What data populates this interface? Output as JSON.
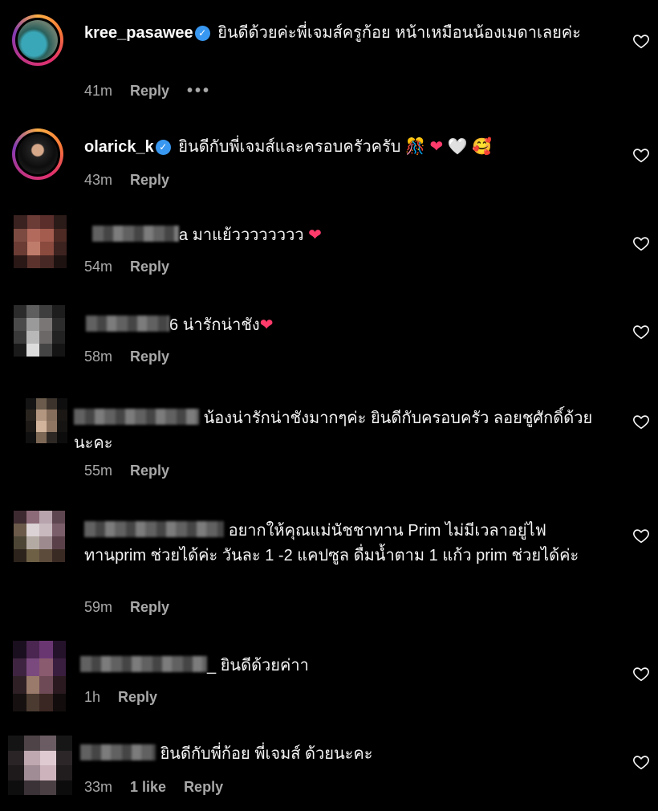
{
  "comments": [
    {
      "username": "kree_pasawee",
      "verified": true,
      "text": "ยินดีด้วยค่ะพี่เจมส์ครูก้อย หน้าเหมือนน้องเมดาเลยค่ะ",
      "time": "41m",
      "reply": "Reply",
      "more": "•••"
    },
    {
      "username": "olarick_k",
      "verified": true,
      "text": "ยินดีกับพี่เจมส์และครอบครัวครับ",
      "emojis": [
        "🎊",
        "❤",
        "🤍",
        "🥰"
      ],
      "time": "43m",
      "reply": "Reply"
    },
    {
      "prefix": "a",
      "text": "มาแย้วววววววว",
      "emojis": [
        "❤"
      ],
      "time": "54m",
      "reply": "Reply"
    },
    {
      "prefix": "6",
      "text": "น่ารักน่าชัง",
      "emojis": [
        "❤"
      ],
      "time": "58m",
      "reply": "Reply"
    },
    {
      "text": "น้องน่ารักน่าชังมากๆค่ะ ยินดีกับครอบครัว ลอยชูศักดิ์ด้วยนะคะ",
      "time": "55m",
      "reply": "Reply"
    },
    {
      "text": "อยากให้คุณแม่นัชชาทาน Prim ไม่มีเวลาอยู่ไฟ ทานprim ช่วยได้ค่ะ วันละ 1 -2 แคปซูล ดื่มน้ำตาม 1 แก้ว prim ช่วยได้ค่ะ",
      "time": "59m",
      "reply": "Reply"
    },
    {
      "prefix": "_",
      "text": "ยินดีด้วยค่าา",
      "time": "1h",
      "reply": "Reply"
    },
    {
      "text": "ยินดีกับพี่ก้อย พี่เจมส์ ด้วยนะคะ",
      "time": "33m",
      "likes": "1 like",
      "reply": "Reply"
    }
  ],
  "icons": {
    "like": "heart-outline-icon",
    "verified": "verified-badge-icon"
  }
}
